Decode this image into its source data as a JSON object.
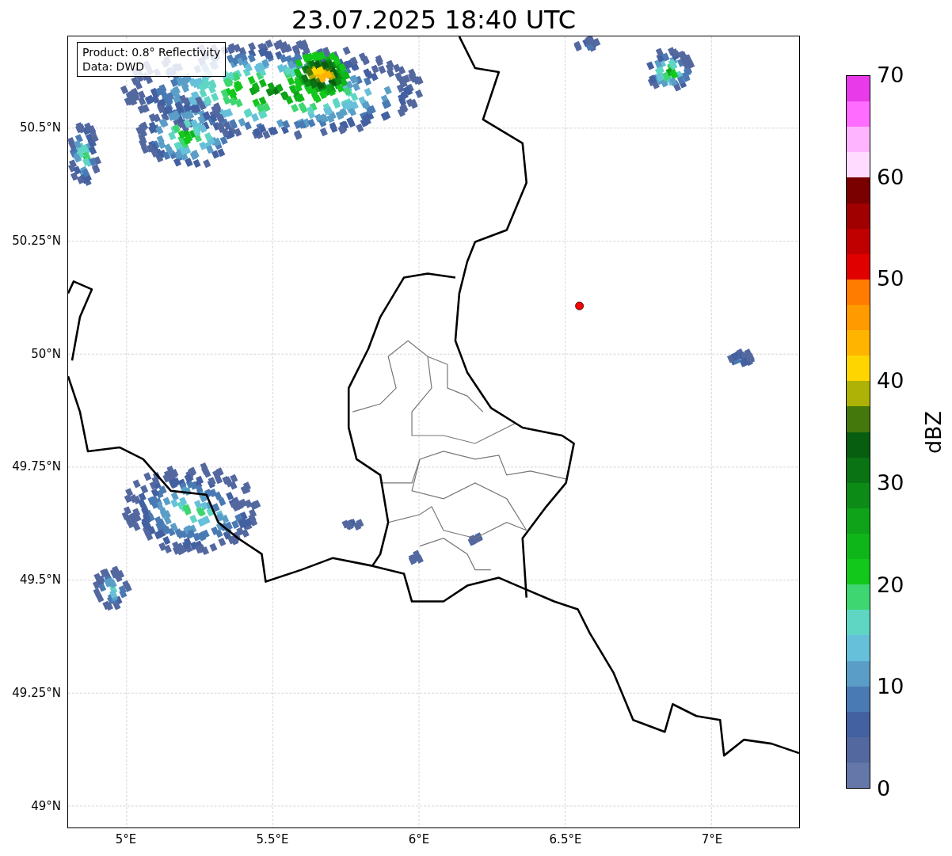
{
  "title": "23.07.2025 18:40 UTC",
  "annotation": [
    "Product: 0.8° Reflectivity",
    "Data: DWD"
  ],
  "y_ticks": [
    "50.5°N",
    "50.25°N",
    "50°N",
    "49.75°N",
    "49.5°N",
    "49.25°N",
    "49°N"
  ],
  "x_ticks": [
    "5°E",
    "5.5°E",
    "6°E",
    "6.5°E",
    "7°E"
  ],
  "colorbar": {
    "label": "dBZ",
    "ticks": [
      "70",
      "60",
      "50",
      "40",
      "30",
      "20",
      "10",
      "0"
    ],
    "bins": [
      {
        "color": "#e93ae9"
      },
      {
        "color": "#ff6cff"
      },
      {
        "color": "#ffb4ff"
      },
      {
        "color": "#ffdcff"
      },
      {
        "color": "#7a0000"
      },
      {
        "color": "#a00000"
      },
      {
        "color": "#c00000"
      },
      {
        "color": "#e00000"
      },
      {
        "color": "#ff7c00"
      },
      {
        "color": "#ff9a00"
      },
      {
        "color": "#ffb400"
      },
      {
        "color": "#ffd500"
      },
      {
        "color": "#aeb106"
      },
      {
        "color": "#45780c"
      },
      {
        "color": "#085e10"
      },
      {
        "color": "#0a7414"
      },
      {
        "color": "#0c8c16"
      },
      {
        "color": "#0ea318"
      },
      {
        "color": "#0fb61a"
      },
      {
        "color": "#11c81b"
      },
      {
        "color": "#3dd670"
      },
      {
        "color": "#5fd6c4"
      },
      {
        "color": "#66c0da"
      },
      {
        "color": "#5a9ec8"
      },
      {
        "color": "#4a7ab3"
      },
      {
        "color": "#4360a0"
      },
      {
        "color": "#5468a0"
      },
      {
        "color": "#6577a8"
      }
    ]
  }
}
